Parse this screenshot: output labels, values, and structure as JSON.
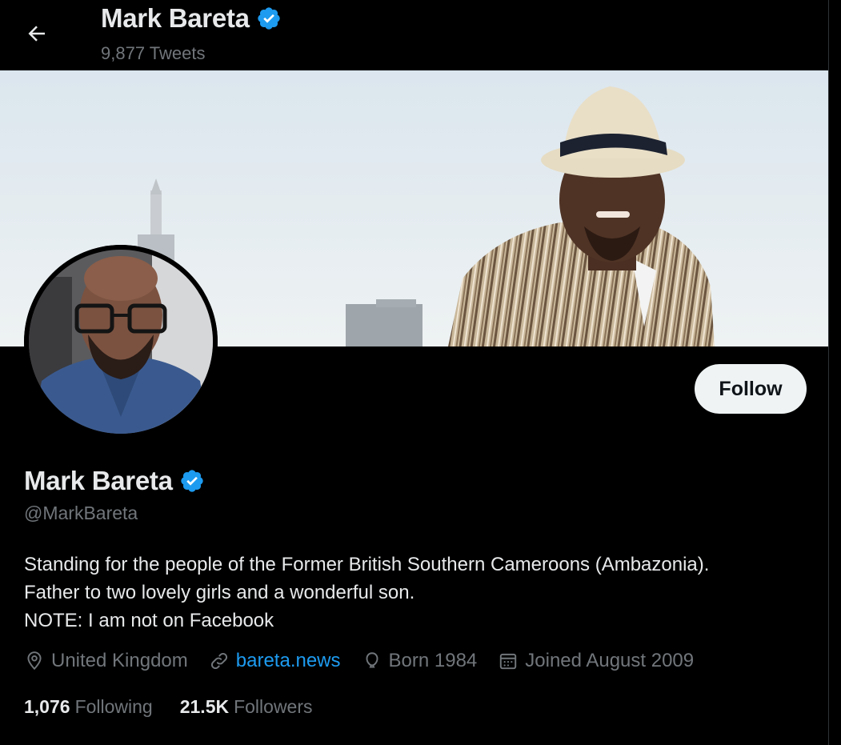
{
  "header": {
    "name": "Mark Bareta",
    "tweets_count": "9,877 Tweets"
  },
  "profile": {
    "display_name": "Mark Bareta",
    "handle": "@MarkBareta",
    "follow_label": "Follow",
    "bio_lines": [
      "Standing for the people of the Former British Southern Cameroons (Ambazonia).",
      "Father to two lovely girls and a wonderful son.",
      "NOTE: I am not on Facebook"
    ],
    "location": "United Kingdom",
    "website": "bareta.news",
    "birth": "Born 1984",
    "joined": "Joined August 2009",
    "following_count": "1,076",
    "following_label": "Following",
    "followers_count": "21.5K",
    "followers_label": "Followers"
  },
  "colors": {
    "background": "#000000",
    "primary_text": "#e7e9ea",
    "secondary_text": "#71767b",
    "link": "#1d9bf0",
    "verified_badge": "#1d9bf0",
    "follow_button_bg": "#eff3f4"
  },
  "icons": {
    "back": "arrow-left-icon",
    "verified": "verified-badge-icon",
    "location": "location-pin-icon",
    "link": "link-icon",
    "birth": "balloon-icon",
    "joined": "calendar-icon"
  }
}
